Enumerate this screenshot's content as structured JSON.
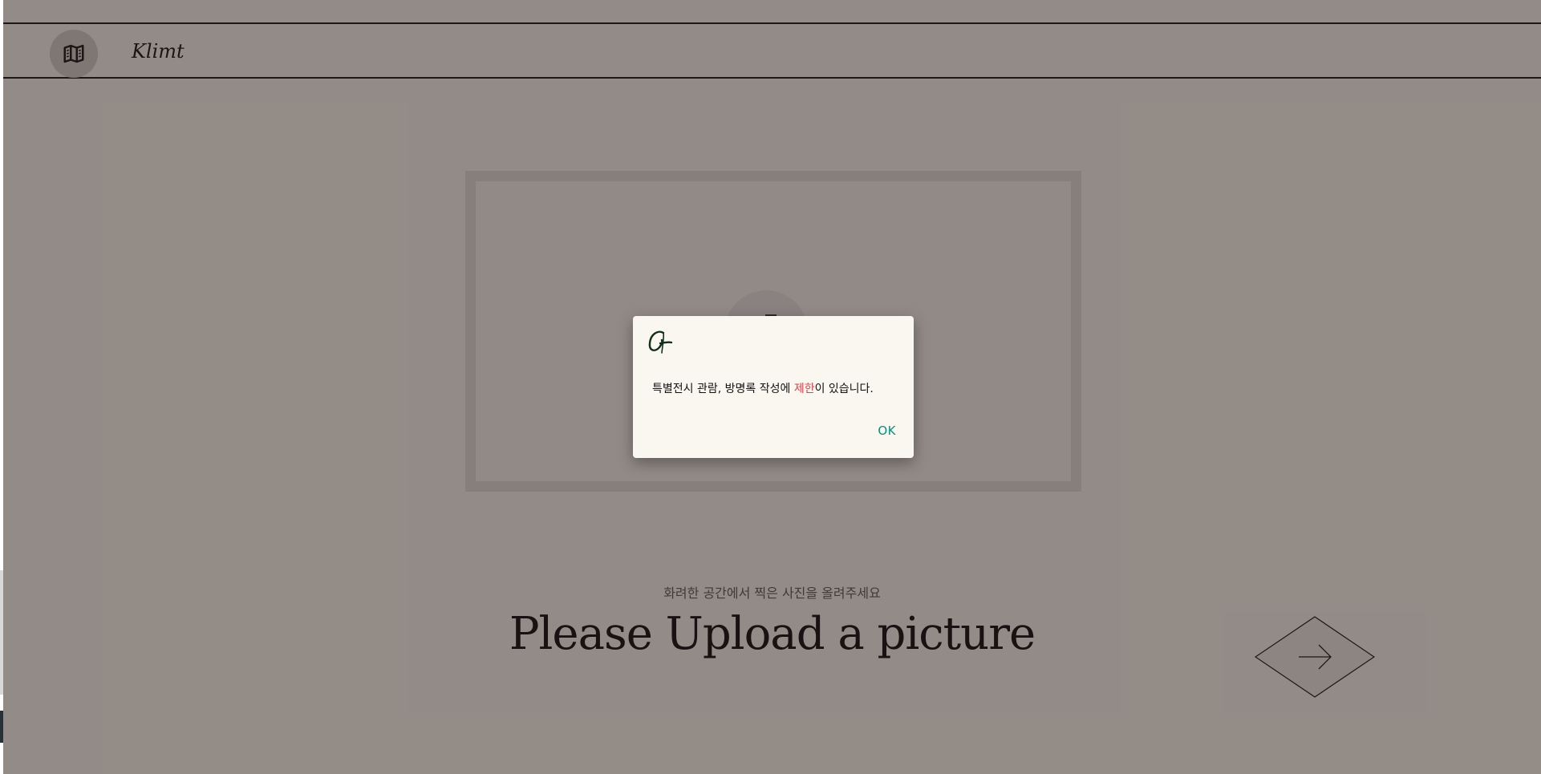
{
  "header": {
    "map_icon": "map-icon",
    "brand": "Klimt"
  },
  "upload": {
    "subtitle": "화려한 공간에서 찍은 사진을 올려주세요",
    "title": "Please Upload a picture",
    "next_icon": "arrow-right-icon"
  },
  "dialog": {
    "logo_icon": "signature-g-logo",
    "message_before": "특별전시 관람, 방명록 작성에 ",
    "message_highlight": "제한",
    "message_after": "이 있습니다.",
    "ok_label": "OK"
  },
  "colors": {
    "page_bg": "#f5f0ea",
    "highlight": "#e0424b",
    "ok": "#0a8f78",
    "dialog_bg": "#faf7f1"
  }
}
